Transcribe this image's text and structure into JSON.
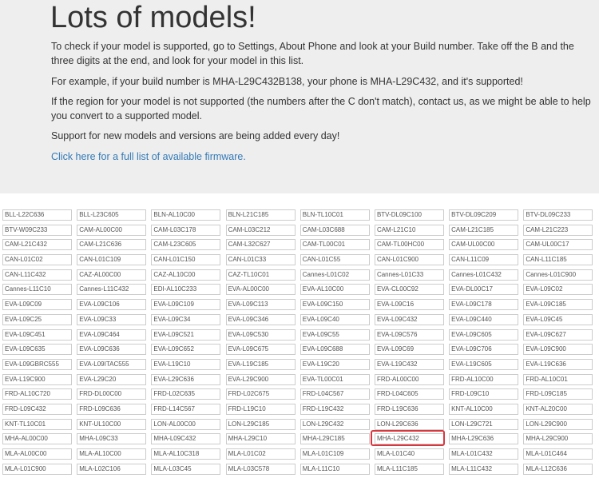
{
  "header": {
    "title": "Lots of models!",
    "intro": "To check if your model is supported, go to Settings, About Phone and look at your Build number. Take off the B and the three digits at the end, and look for your model in this list.",
    "example": "For example, if your build number is MHA-L29C432B138, your phone is MHA-L29C432, and it's supported!",
    "region_note": "If the region for your model is not supported (the numbers after the C don't match), contact us, as we might be able to help you convert to a supported model.",
    "support_note": "Support for new models and versions are being added every day!",
    "firmware_link": "Click here for a full list of available firmware."
  },
  "highlighted_model": "MHA-L29C432",
  "models": [
    "BLL-L22C636",
    "BLL-L23C605",
    "BLN-AL10C00",
    "BLN-L21C185",
    "BLN-TL10C01",
    "BTV-DL09C100",
    "BTV-DL09C209",
    "BTV-DL09C233",
    "BTV-W09C233",
    "CAM-AL00C00",
    "CAM-L03C178",
    "CAM-L03C212",
    "CAM-L03C688",
    "CAM-L21C10",
    "CAM-L21C185",
    "CAM-L21C223",
    "CAM-L21C432",
    "CAM-L21C636",
    "CAM-L23C605",
    "CAM-L32C627",
    "CAM-TL00C01",
    "CAM-TL00HC00",
    "CAM-UL00C00",
    "CAM-UL00C17",
    "CAN-L01C02",
    "CAN-L01C109",
    "CAN-L01C150",
    "CAN-L01C33",
    "CAN-L01C55",
    "CAN-L01C900",
    "CAN-L11C09",
    "CAN-L11C185",
    "CAN-L11C432",
    "CAZ-AL00C00",
    "CAZ-AL10C00",
    "CAZ-TL10C01",
    "Cannes-L01C02",
    "Cannes-L01C33",
    "Cannes-L01C432",
    "Cannes-L01C900",
    "Cannes-L11C10",
    "Cannes-L11C432",
    "EDI-AL10C233",
    "EVA-AL00C00",
    "EVA-AL10C00",
    "EVA-CL00C92",
    "EVA-DL00C17",
    "EVA-L09C02",
    "EVA-L09C09",
    "EVA-L09C106",
    "EVA-L09C109",
    "EVA-L09C113",
    "EVA-L09C150",
    "EVA-L09C16",
    "EVA-L09C178",
    "EVA-L09C185",
    "EVA-L09C25",
    "EVA-L09C33",
    "EVA-L09C34",
    "EVA-L09C346",
    "EVA-L09C40",
    "EVA-L09C432",
    "EVA-L09C440",
    "EVA-L09C45",
    "EVA-L09C451",
    "EVA-L09C464",
    "EVA-L09C521",
    "EVA-L09C530",
    "EVA-L09C55",
    "EVA-L09C576",
    "EVA-L09C605",
    "EVA-L09C627",
    "EVA-L09C635",
    "EVA-L09C636",
    "EVA-L09C652",
    "EVA-L09C675",
    "EVA-L09C688",
    "EVA-L09C69",
    "EVA-L09C706",
    "EVA-L09C900",
    "EVA-L09GBRC555",
    "EVA-L09ITAC555",
    "EVA-L19C10",
    "EVA-L19C185",
    "EVA-L19C20",
    "EVA-L19C432",
    "EVA-L19C605",
    "EVA-L19C636",
    "EVA-L19C900",
    "EVA-L29C20",
    "EVA-L29C636",
    "EVA-L29C900",
    "EVA-TL00C01",
    "FRD-AL00C00",
    "FRD-AL10C00",
    "FRD-AL10C01",
    "FRD-AL10C720",
    "FRD-DL00C00",
    "FRD-L02C635",
    "FRD-L02C675",
    "FRD-L04C567",
    "FRD-L04C605",
    "FRD-L09C10",
    "FRD-L09C185",
    "FRD-L09C432",
    "FRD-L09C636",
    "FRD-L14C567",
    "FRD-L19C10",
    "FRD-L19C432",
    "FRD-L19C636",
    "KNT-AL10C00",
    "KNT-AL20C00",
    "KNT-TL10C01",
    "KNT-UL10C00",
    "LON-AL00C00",
    "LON-L29C185",
    "LON-L29C432",
    "LON-L29C636",
    "LON-L29C721",
    "LON-L29C900",
    "MHA-AL00C00",
    "MHA-L09C33",
    "MHA-L09C432",
    "MHA-L29C10",
    "MHA-L29C185",
    "MHA-L29C432",
    "MHA-L29C636",
    "MHA-L29C900",
    "MLA-AL00C00",
    "MLA-AL10C00",
    "MLA-AL10C318",
    "MLA-L01C02",
    "MLA-L01C109",
    "MLA-L01C40",
    "MLA-L01C432",
    "MLA-L01C464",
    "MLA-L01C900",
    "MLA-L02C106",
    "MLA-L03C45",
    "MLA-L03C578",
    "MLA-L11C10",
    "MLA-L11C185",
    "MLA-L11C432",
    "MLA-L12C636"
  ]
}
